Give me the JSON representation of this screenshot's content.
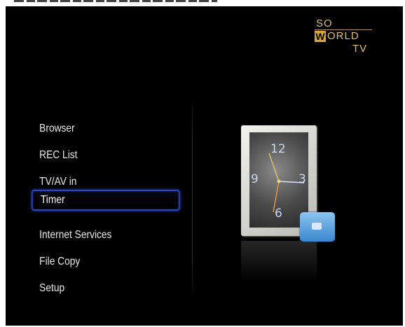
{
  "logo": {
    "line1": "SO",
    "w": "W",
    "line2": "ORLD",
    "line3": "TV"
  },
  "menu": {
    "items": [
      {
        "label": "Browser",
        "selected": false
      },
      {
        "label": "REC  List",
        "selected": false
      },
      {
        "label": "TV/AV in",
        "selected": false
      },
      {
        "label": "Timer",
        "selected": true
      },
      {
        "label": "Internet Services",
        "selected": false
      },
      {
        "label": "File Copy",
        "selected": false
      },
      {
        "label": "Setup",
        "selected": false
      }
    ]
  },
  "clock": {
    "numbers": {
      "top": "12",
      "right": "3",
      "bottom": "6",
      "left": "9"
    }
  },
  "colors": {
    "background": "#000000",
    "selection": "#3044b8",
    "logo": "#d8a640",
    "text": "#e9e9e9"
  }
}
